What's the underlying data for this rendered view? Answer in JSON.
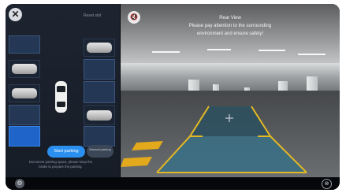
{
  "header": {
    "close_icon": "close-icon",
    "top_right_label": "Reset slot"
  },
  "parking_panel": {
    "start_button_label": "Start parking",
    "more_button_label": "Manual parking",
    "hint_text": "Document parking space, please keep the brake to prepare the parking.",
    "colors": {
      "selected_slot": "#1f64c8",
      "start_button": "#2b8ff0"
    }
  },
  "camera": {
    "title": "Rear View",
    "message_line1": "Please pay attention to the surrounding",
    "message_line2": "environment and ensure safety!",
    "mute_icon": "speaker-mute-icon",
    "guide_color": "#e4b824"
  },
  "bottom": {
    "settings_icon": "gear-icon",
    "exit_icon": "exit-icon"
  }
}
